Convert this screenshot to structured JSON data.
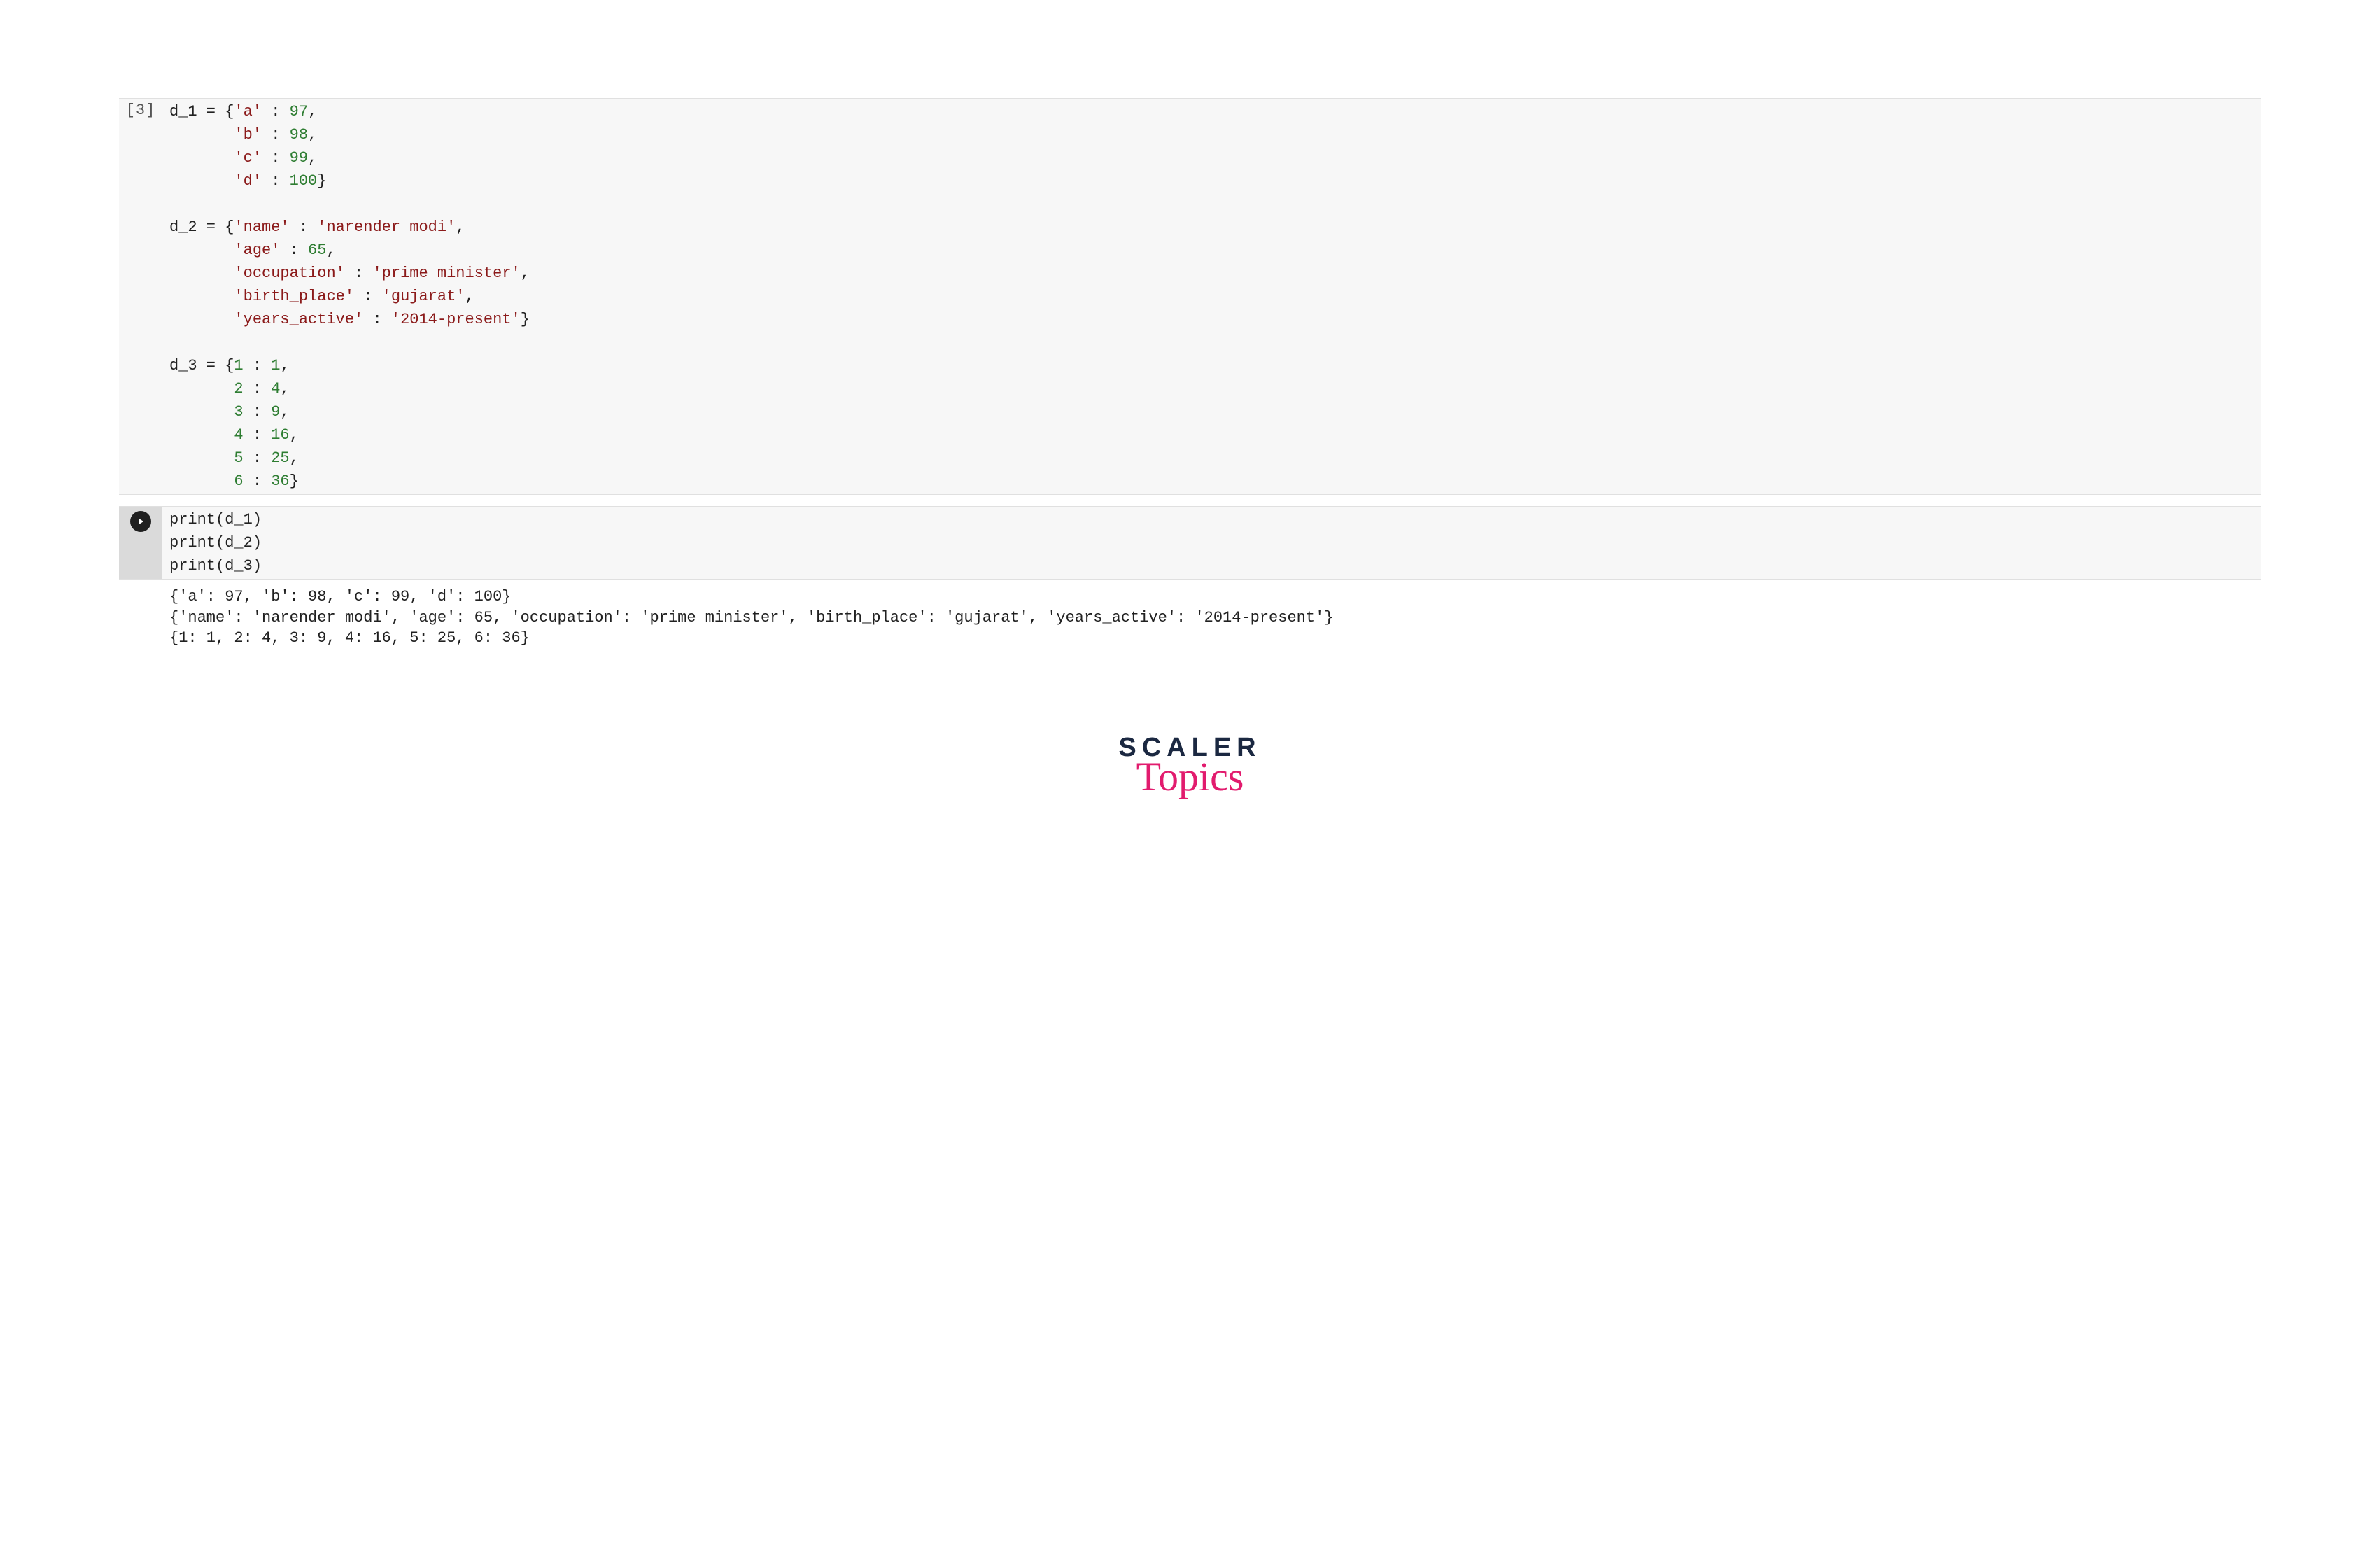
{
  "cell1": {
    "prompt": "[3]",
    "code_tokens": [
      [
        {
          "t": "d_1",
          "c": "nm"
        },
        {
          "t": " = {",
          "c": "pn"
        },
        {
          "t": "'a'",
          "c": "st"
        },
        {
          "t": " : ",
          "c": "op"
        },
        {
          "t": "97",
          "c": "nu"
        },
        {
          "t": ",",
          "c": "pn"
        }
      ],
      [
        {
          "t": "       ",
          "c": "pn"
        },
        {
          "t": "'b'",
          "c": "st"
        },
        {
          "t": " : ",
          "c": "op"
        },
        {
          "t": "98",
          "c": "nu"
        },
        {
          "t": ",",
          "c": "pn"
        }
      ],
      [
        {
          "t": "       ",
          "c": "pn"
        },
        {
          "t": "'c'",
          "c": "st"
        },
        {
          "t": " : ",
          "c": "op"
        },
        {
          "t": "99",
          "c": "nu"
        },
        {
          "t": ",",
          "c": "pn"
        }
      ],
      [
        {
          "t": "       ",
          "c": "pn"
        },
        {
          "t": "'d'",
          "c": "st"
        },
        {
          "t": " : ",
          "c": "op"
        },
        {
          "t": "100",
          "c": "nu"
        },
        {
          "t": "}",
          "c": "pn"
        }
      ],
      [
        {
          "t": "",
          "c": "pn"
        }
      ],
      [
        {
          "t": "d_2",
          "c": "nm"
        },
        {
          "t": " = {",
          "c": "pn"
        },
        {
          "t": "'name'",
          "c": "st"
        },
        {
          "t": " : ",
          "c": "op"
        },
        {
          "t": "'narender modi'",
          "c": "st"
        },
        {
          "t": ",",
          "c": "pn"
        }
      ],
      [
        {
          "t": "       ",
          "c": "pn"
        },
        {
          "t": "'age'",
          "c": "st"
        },
        {
          "t": " : ",
          "c": "op"
        },
        {
          "t": "65",
          "c": "nu"
        },
        {
          "t": ",",
          "c": "pn"
        }
      ],
      [
        {
          "t": "       ",
          "c": "pn"
        },
        {
          "t": "'occupation'",
          "c": "st"
        },
        {
          "t": " : ",
          "c": "op"
        },
        {
          "t": "'prime minister'",
          "c": "st"
        },
        {
          "t": ",",
          "c": "pn"
        }
      ],
      [
        {
          "t": "       ",
          "c": "pn"
        },
        {
          "t": "'birth_place'",
          "c": "st"
        },
        {
          "t": " : ",
          "c": "op"
        },
        {
          "t": "'gujarat'",
          "c": "st"
        },
        {
          "t": ",",
          "c": "pn"
        }
      ],
      [
        {
          "t": "       ",
          "c": "pn"
        },
        {
          "t": "'years_active'",
          "c": "st"
        },
        {
          "t": " : ",
          "c": "op"
        },
        {
          "t": "'2014-present'",
          "c": "st"
        },
        {
          "t": "}",
          "c": "pn"
        }
      ],
      [
        {
          "t": "",
          "c": "pn"
        }
      ],
      [
        {
          "t": "d_3",
          "c": "nm"
        },
        {
          "t": " = {",
          "c": "pn"
        },
        {
          "t": "1",
          "c": "nu"
        },
        {
          "t": " : ",
          "c": "op"
        },
        {
          "t": "1",
          "c": "nu"
        },
        {
          "t": ",",
          "c": "pn"
        }
      ],
      [
        {
          "t": "       ",
          "c": "pn"
        },
        {
          "t": "2",
          "c": "nu"
        },
        {
          "t": " : ",
          "c": "op"
        },
        {
          "t": "4",
          "c": "nu"
        },
        {
          "t": ",",
          "c": "pn"
        }
      ],
      [
        {
          "t": "       ",
          "c": "pn"
        },
        {
          "t": "3",
          "c": "nu"
        },
        {
          "t": " : ",
          "c": "op"
        },
        {
          "t": "9",
          "c": "nu"
        },
        {
          "t": ",",
          "c": "pn"
        }
      ],
      [
        {
          "t": "       ",
          "c": "pn"
        },
        {
          "t": "4",
          "c": "nu"
        },
        {
          "t": " : ",
          "c": "op"
        },
        {
          "t": "16",
          "c": "nu"
        },
        {
          "t": ",",
          "c": "pn"
        }
      ],
      [
        {
          "t": "       ",
          "c": "pn"
        },
        {
          "t": "5",
          "c": "nu"
        },
        {
          "t": " : ",
          "c": "op"
        },
        {
          "t": "25",
          "c": "nu"
        },
        {
          "t": ",",
          "c": "pn"
        }
      ],
      [
        {
          "t": "       ",
          "c": "pn"
        },
        {
          "t": "6",
          "c": "nu"
        },
        {
          "t": " : ",
          "c": "op"
        },
        {
          "t": "36",
          "c": "nu"
        },
        {
          "t": "}",
          "c": "pn"
        }
      ]
    ]
  },
  "cell2": {
    "code_tokens": [
      [
        {
          "t": "print",
          "c": "fn"
        },
        {
          "t": "(d_1)",
          "c": "pn"
        }
      ],
      [
        {
          "t": "print",
          "c": "fn"
        },
        {
          "t": "(d_2)",
          "c": "pn"
        }
      ],
      [
        {
          "t": "print",
          "c": "fn"
        },
        {
          "t": "(d_3)",
          "c": "pn"
        }
      ]
    ],
    "output_lines": [
      "{'a': 97, 'b': 98, 'c': 99, 'd': 100}",
      "{'name': 'narender modi', 'age': 65, 'occupation': 'prime minister', 'birth_place': 'gujarat', 'years_active': '2014-present'}",
      "{1: 1, 2: 4, 3: 9, 4: 16, 5: 25, 6: 36}"
    ]
  },
  "logo": {
    "line1": "SCALER",
    "line2": "Topics"
  }
}
